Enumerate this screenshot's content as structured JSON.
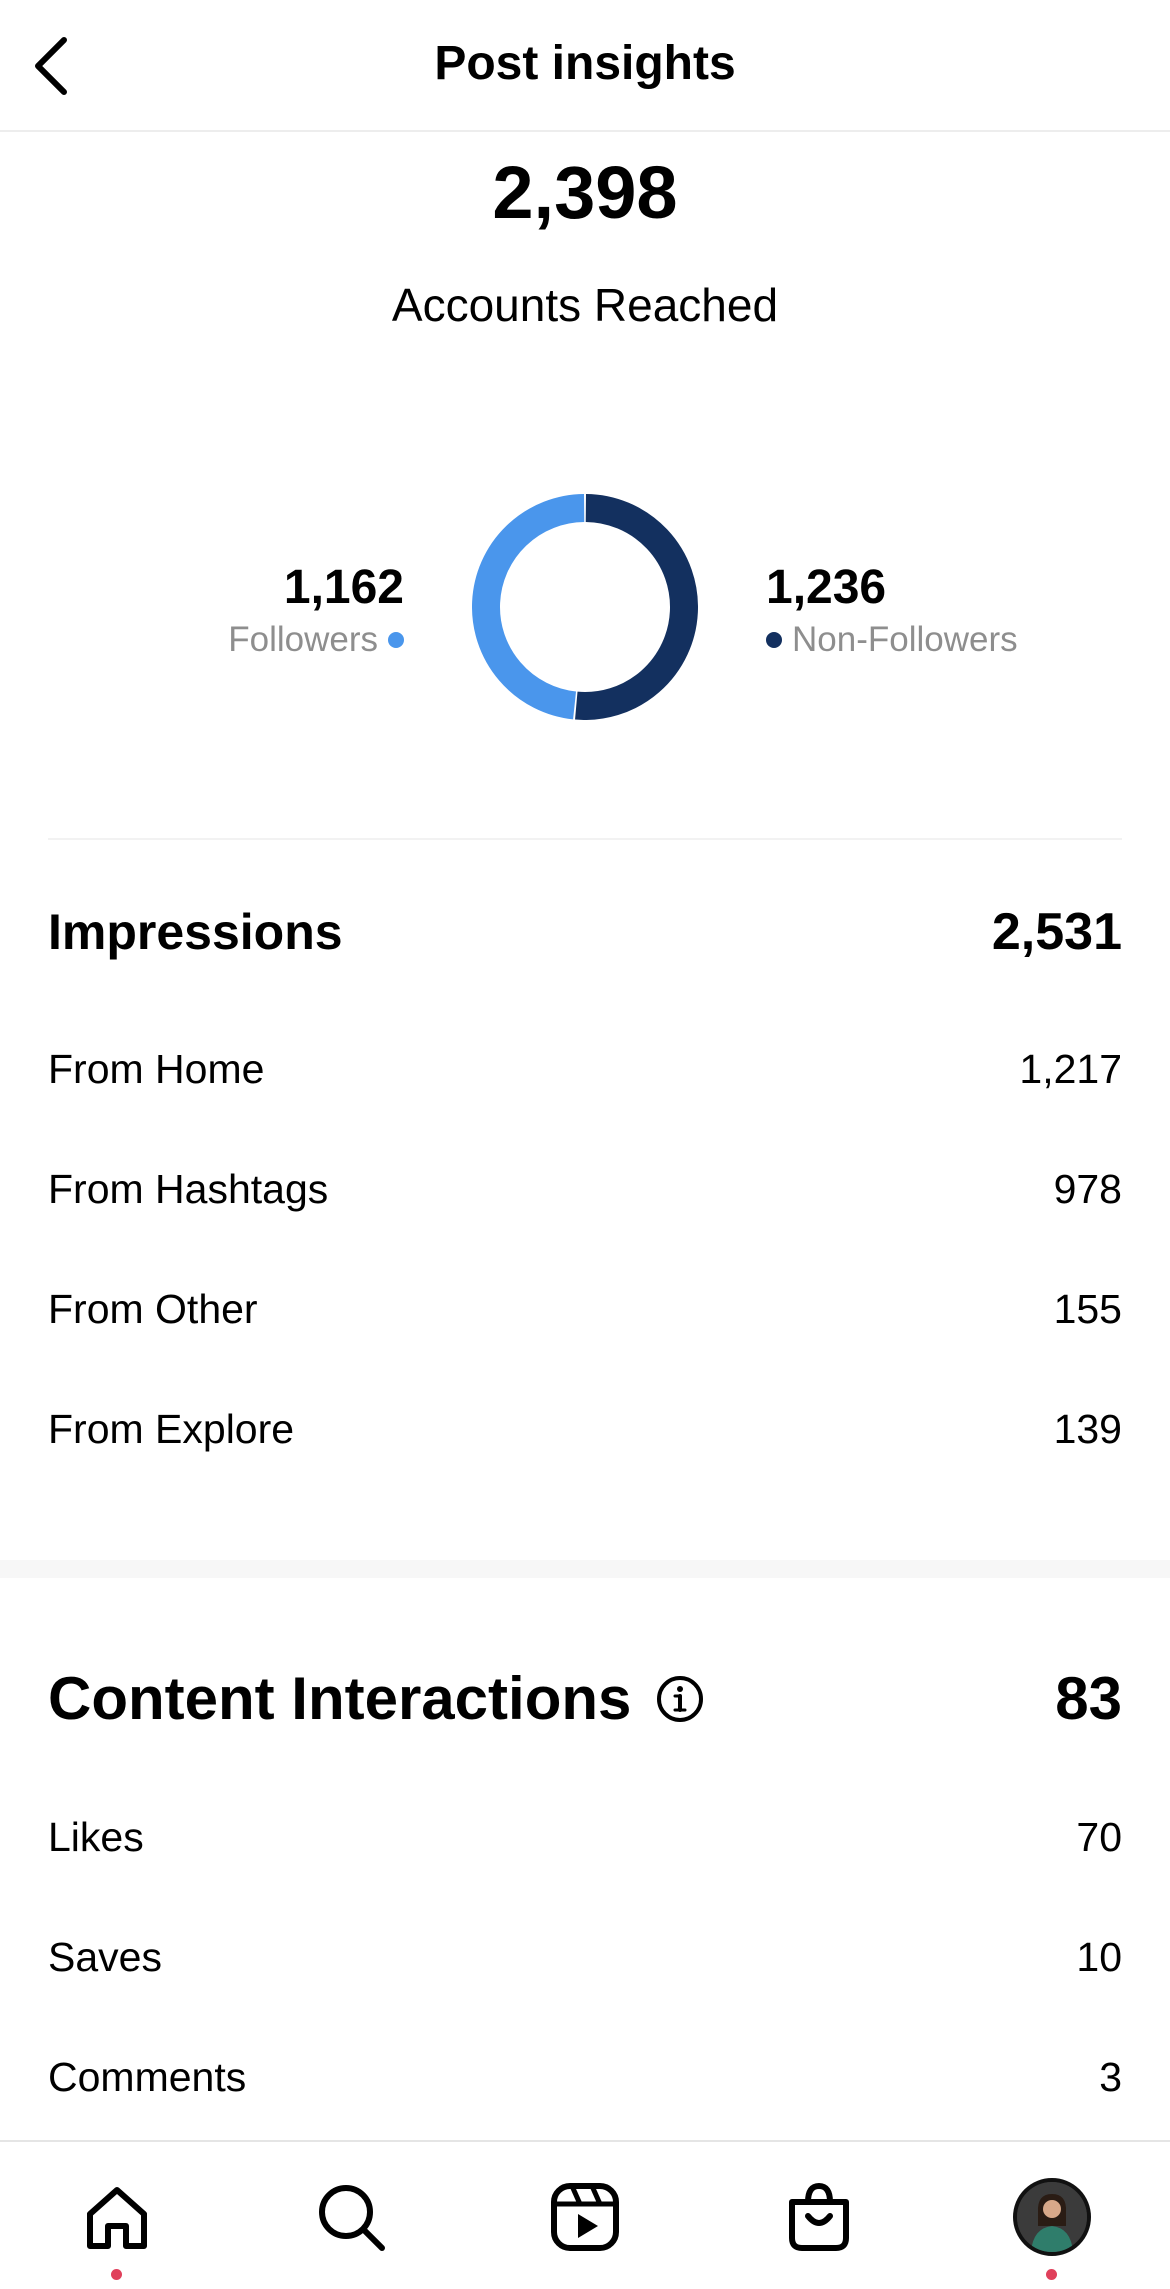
{
  "header": {
    "title": "Post insights"
  },
  "reach": {
    "value": "2,398",
    "label": "Accounts Reached"
  },
  "audience": {
    "followers": {
      "value": "1,162",
      "label": "Followers",
      "color": "#4a96ec",
      "count": 1162
    },
    "non_followers": {
      "value": "1,236",
      "label": "Non-Followers",
      "color": "#13305f",
      "count": 1236
    }
  },
  "impressions": {
    "title": "Impressions",
    "total": "2,531",
    "rows": [
      {
        "label": "From Home",
        "value": "1,217"
      },
      {
        "label": "From Hashtags",
        "value": "978"
      },
      {
        "label": "From Other",
        "value": "155"
      },
      {
        "label": "From Explore",
        "value": "139"
      }
    ]
  },
  "interactions": {
    "title": "Content Interactions",
    "total": "83",
    "rows": [
      {
        "label": "Likes",
        "value": "70"
      },
      {
        "label": "Saves",
        "value": "10"
      },
      {
        "label": "Comments",
        "value": "3"
      }
    ]
  },
  "tabbar": {
    "items": [
      "home-icon",
      "search-icon",
      "reels-icon",
      "shop-icon",
      "profile-avatar"
    ],
    "notification_color": "#e0405b"
  }
}
